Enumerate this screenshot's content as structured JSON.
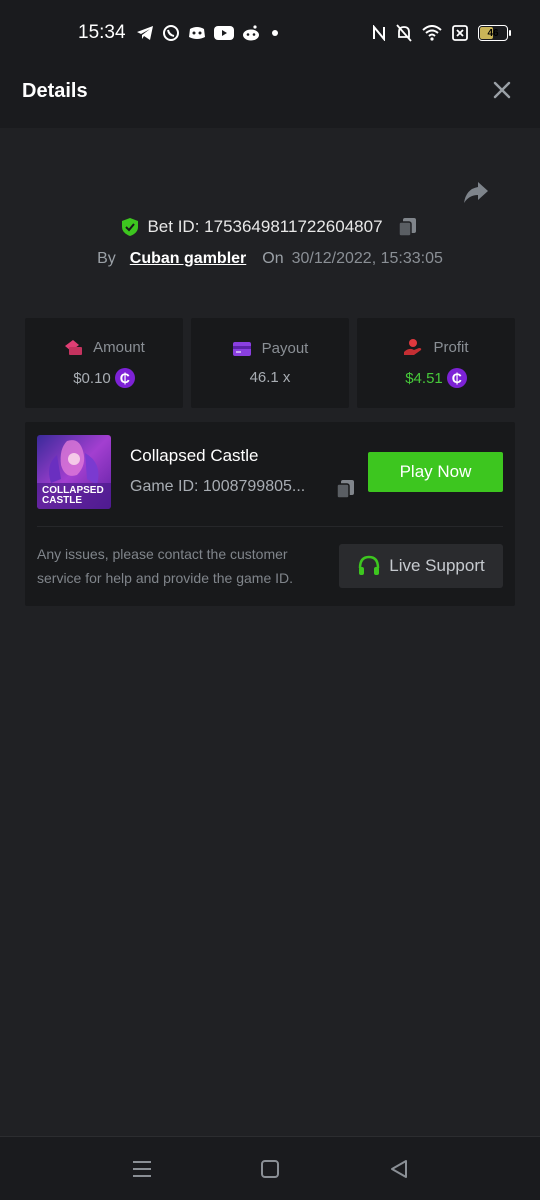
{
  "status_bar": {
    "time": "15:34",
    "battery": "46",
    "left_icons": [
      "telegram-icon",
      "whatsapp-icon",
      "discord-icon",
      "youtube-icon",
      "reddit-icon",
      "dot-icon"
    ],
    "right_icons": [
      "nfc-icon",
      "bell-off-icon",
      "wifi-icon",
      "no-sim-icon",
      "battery-icon"
    ]
  },
  "header": {
    "title": "Details"
  },
  "bet": {
    "id_label": "Bet ID: 1753649811722604807",
    "by_label": "By",
    "user": "Cuban gambler",
    "on_label": "On",
    "date": "30/12/2022, 15:33:05"
  },
  "stats": {
    "amount": {
      "label": "Amount",
      "value": "$0.10"
    },
    "payout": {
      "label": "Payout",
      "value": "46.1 x"
    },
    "profit": {
      "label": "Profit",
      "value": "$4.51"
    },
    "coin_symbol": "₵"
  },
  "game": {
    "name": "Collapsed Castle",
    "id_label": "Game ID: 1008799805...",
    "thumb_text_line1": "COLLAPSED",
    "thumb_text_line2": "CASTLE",
    "play_label": "Play Now"
  },
  "support": {
    "note": "Any issues, please contact the customer service for help and provide the game ID.",
    "button_label": "Live Support"
  },
  "colors": {
    "accent_green": "#3dc61f",
    "profit_green": "#46c83a",
    "coin_purple": "#7d22d6",
    "background": "#202124",
    "card": "#18191b"
  }
}
